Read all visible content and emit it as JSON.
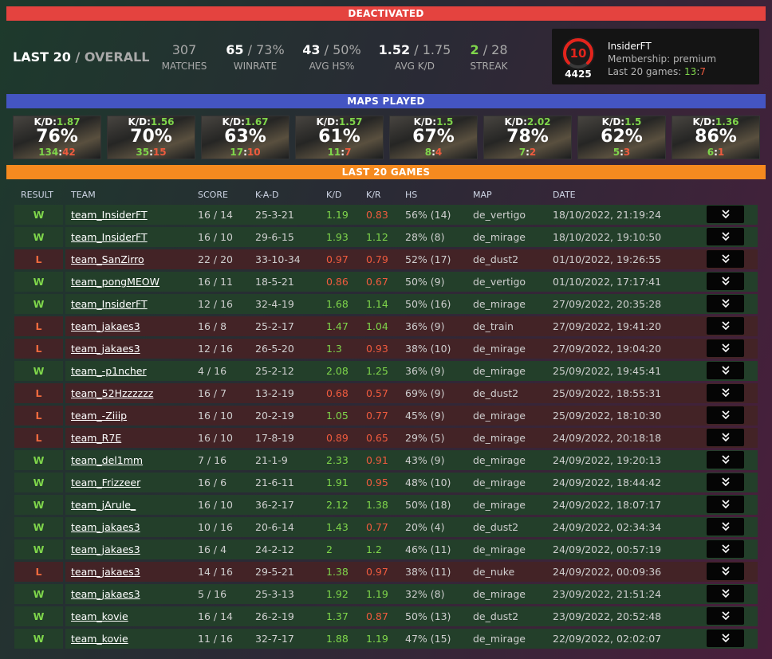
{
  "banners": {
    "status": "DEACTIVATED",
    "maps": "MAPS PLAYED",
    "games": "LAST 20 GAMES"
  },
  "header": {
    "title_main": "LAST 20",
    "title_alt": "/ OVERALL",
    "stats": [
      {
        "main": "307",
        "alt": "",
        "label": "MATCHES"
      },
      {
        "main": "65",
        "alt": " / 73%",
        "label": "WINRATE"
      },
      {
        "main": "43",
        "alt": " / 50%",
        "label": "AVG HS%"
      },
      {
        "main": "1.52",
        "alt": " / 1.75",
        "label": "AVG K/D"
      },
      {
        "main": "2",
        "alt": " / 28",
        "label": "STREAK"
      }
    ]
  },
  "profile": {
    "level": "10",
    "elo": "4425",
    "name": "InsiderFT",
    "membership": "Membership: premium",
    "last20_label": "Last 20 games: ",
    "wins": "13",
    "sep": ":",
    "losses": "7",
    "colors": {
      "level_ring": "#e4241c"
    }
  },
  "maps": [
    {
      "kd_label": "K/D:",
      "kd": "1.87",
      "pct": "76%",
      "w": "134",
      "sep": ":",
      "l": "42"
    },
    {
      "kd_label": "K/D:",
      "kd": "1.56",
      "pct": "70%",
      "w": "35",
      "sep": ":",
      "l": "15"
    },
    {
      "kd_label": "K/D:",
      "kd": "1.67",
      "pct": "63%",
      "w": "17",
      "sep": ":",
      "l": "10"
    },
    {
      "kd_label": "K/D:",
      "kd": "1.57",
      "pct": "61%",
      "w": "11",
      "sep": ":",
      "l": "7"
    },
    {
      "kd_label": "K/D:",
      "kd": "1.5",
      "pct": "67%",
      "w": "8",
      "sep": ":",
      "l": "4"
    },
    {
      "kd_label": "K/D:",
      "kd": "2.02",
      "pct": "78%",
      "w": "7",
      "sep": ":",
      "l": "2"
    },
    {
      "kd_label": "K/D:",
      "kd": "1.5",
      "pct": "62%",
      "w": "5",
      "sep": ":",
      "l": "3"
    },
    {
      "kd_label": "K/D:",
      "kd": "1.36",
      "pct": "86%",
      "w": "6",
      "sep": ":",
      "l": "1"
    }
  ],
  "table": {
    "headers": [
      "RESULT",
      "TEAM",
      "SCORE",
      "K-A-D",
      "K/D",
      "K/R",
      "HS",
      "MAP",
      "DATE"
    ],
    "rows": [
      {
        "result": "W",
        "team": "team_InsiderFT",
        "score": "16 / 14",
        "kad": "25-3-21",
        "kd": "1.19",
        "kd_good": true,
        "kr": "0.83",
        "kr_good": false,
        "hs": "56% (14)",
        "map": "de_vertigo",
        "date": "18/10/2022, 21:19:24"
      },
      {
        "result": "W",
        "team": "team_InsiderFT",
        "score": "16 / 10",
        "kad": "29-6-15",
        "kd": "1.93",
        "kd_good": true,
        "kr": "1.12",
        "kr_good": true,
        "hs": "28% (8)",
        "map": "de_mirage",
        "date": "18/10/2022, 19:10:50"
      },
      {
        "result": "L",
        "team": "team_SanZirro",
        "score": "22 / 20",
        "kad": "33-10-34",
        "kd": "0.97",
        "kd_good": false,
        "kr": "0.79",
        "kr_good": false,
        "hs": "52% (17)",
        "map": "de_dust2",
        "date": "01/10/2022, 19:26:55"
      },
      {
        "result": "W",
        "team": "team_pongMEOW",
        "score": "16 / 11",
        "kad": "18-5-21",
        "kd": "0.86",
        "kd_good": false,
        "kr": "0.67",
        "kr_good": false,
        "hs": "50% (9)",
        "map": "de_vertigo",
        "date": "01/10/2022, 17:17:41"
      },
      {
        "result": "W",
        "team": "team_InsiderFT",
        "score": "12 / 16",
        "kad": "32-4-19",
        "kd": "1.68",
        "kd_good": true,
        "kr": "1.14",
        "kr_good": true,
        "hs": "50% (16)",
        "map": "de_mirage",
        "date": "27/09/2022, 20:35:28"
      },
      {
        "result": "L",
        "team": "team_jakaes3",
        "score": "16 / 8",
        "kad": "25-2-17",
        "kd": "1.47",
        "kd_good": true,
        "kr": "1.04",
        "kr_good": true,
        "hs": "36% (9)",
        "map": "de_train",
        "date": "27/09/2022, 19:41:20"
      },
      {
        "result": "L",
        "team": "team_jakaes3",
        "score": "12 / 16",
        "kad": "26-5-20",
        "kd": "1.3",
        "kd_good": true,
        "kr": "0.93",
        "kr_good": false,
        "hs": "38% (10)",
        "map": "de_mirage",
        "date": "27/09/2022, 19:04:20"
      },
      {
        "result": "W",
        "team": "team_-p1ncher",
        "score": "4 / 16",
        "kad": "25-2-12",
        "kd": "2.08",
        "kd_good": true,
        "kr": "1.25",
        "kr_good": true,
        "hs": "36% (9)",
        "map": "de_mirage",
        "date": "25/09/2022, 19:45:41"
      },
      {
        "result": "L",
        "team": "team_52Hzzzzzz",
        "score": "16 / 7",
        "kad": "13-2-19",
        "kd": "0.68",
        "kd_good": false,
        "kr": "0.57",
        "kr_good": false,
        "hs": "69% (9)",
        "map": "de_dust2",
        "date": "25/09/2022, 18:55:31"
      },
      {
        "result": "L",
        "team": "team_-Ziiip",
        "score": "16 / 10",
        "kad": "20-2-19",
        "kd": "1.05",
        "kd_good": true,
        "kr": "0.77",
        "kr_good": false,
        "hs": "45% (9)",
        "map": "de_mirage",
        "date": "25/09/2022, 18:10:30"
      },
      {
        "result": "L",
        "team": "team_R7E",
        "score": "16 / 10",
        "kad": "17-8-19",
        "kd": "0.89",
        "kd_good": false,
        "kr": "0.65",
        "kr_good": false,
        "hs": "29% (5)",
        "map": "de_mirage",
        "date": "24/09/2022, 20:18:18"
      },
      {
        "result": "W",
        "team": "team_del1mm",
        "score": "7 / 16",
        "kad": "21-1-9",
        "kd": "2.33",
        "kd_good": true,
        "kr": "0.91",
        "kr_good": false,
        "hs": "43% (9)",
        "map": "de_mirage",
        "date": "24/09/2022, 19:20:13"
      },
      {
        "result": "W",
        "team": "team_Frizzeer",
        "score": "16 / 6",
        "kad": "21-6-11",
        "kd": "1.91",
        "kd_good": true,
        "kr": "0.95",
        "kr_good": false,
        "hs": "48% (10)",
        "map": "de_mirage",
        "date": "24/09/2022, 18:44:42"
      },
      {
        "result": "W",
        "team": "team_jArule_",
        "score": "16 / 10",
        "kad": "36-2-17",
        "kd": "2.12",
        "kd_good": true,
        "kr": "1.38",
        "kr_good": true,
        "hs": "50% (18)",
        "map": "de_mirage",
        "date": "24/09/2022, 18:07:17"
      },
      {
        "result": "W",
        "team": "team_jakaes3",
        "score": "10 / 16",
        "kad": "20-6-14",
        "kd": "1.43",
        "kd_good": true,
        "kr": "0.77",
        "kr_good": false,
        "hs": "20% (4)",
        "map": "de_dust2",
        "date": "24/09/2022, 02:34:34"
      },
      {
        "result": "W",
        "team": "team_jakaes3",
        "score": "16 / 4",
        "kad": "24-2-12",
        "kd": "2",
        "kd_good": true,
        "kr": "1.2",
        "kr_good": true,
        "hs": "46% (11)",
        "map": "de_mirage",
        "date": "24/09/2022, 00:57:19"
      },
      {
        "result": "L",
        "team": "team_jakaes3",
        "score": "14 / 16",
        "kad": "29-5-21",
        "kd": "1.38",
        "kd_good": true,
        "kr": "0.97",
        "kr_good": false,
        "hs": "38% (11)",
        "map": "de_nuke",
        "date": "24/09/2022, 00:09:36"
      },
      {
        "result": "W",
        "team": "team_jakaes3",
        "score": "5 / 16",
        "kad": "25-3-13",
        "kd": "1.92",
        "kd_good": true,
        "kr": "1.19",
        "kr_good": true,
        "hs": "32% (8)",
        "map": "de_mirage",
        "date": "23/09/2022, 21:51:24"
      },
      {
        "result": "W",
        "team": "team_kovie",
        "score": "16 / 14",
        "kad": "26-2-19",
        "kd": "1.37",
        "kd_good": true,
        "kr": "0.87",
        "kr_good": false,
        "hs": "50% (13)",
        "map": "de_dust2",
        "date": "23/09/2022, 20:52:48"
      },
      {
        "result": "W",
        "team": "team_kovie",
        "score": "11 / 16",
        "kad": "32-7-17",
        "kd": "1.88",
        "kd_good": true,
        "kr": "1.19",
        "kr_good": true,
        "hs": "47% (15)",
        "map": "de_mirage",
        "date": "22/09/2022, 02:02:07"
      }
    ]
  },
  "colors": {
    "good": "#7fd64b",
    "bad": "#ef5b3e",
    "win_row": "#233f2a",
    "loss_row": "#432326"
  }
}
